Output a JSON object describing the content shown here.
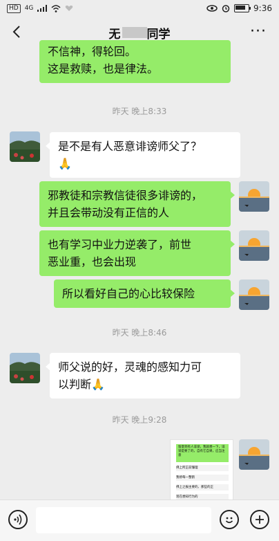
{
  "status_bar": {
    "left_badge": "HD",
    "network": "4G",
    "time": "9:36"
  },
  "header": {
    "title_prefix": "无",
    "title_suffix": "同学"
  },
  "messages": [
    {
      "side": "right",
      "line1": "不信神，得轮回。",
      "line2": "这是救赎，也是律法。"
    },
    {
      "side": "left",
      "line1": "是不是有人恶意诽谤师父了？",
      "line2": "🙏"
    },
    {
      "side": "right",
      "line1": "邪教徒和宗教信徒很多诽谤的，",
      "line2": "并且会带动没有正信的人"
    },
    {
      "side": "right",
      "line1": "也有学习中业力逆袭了，前世",
      "line2": "恶业重，也会出现"
    },
    {
      "side": "right",
      "line1": "所以看好自己的心比较保险"
    },
    {
      "side": "left",
      "line1": "师父说的好，灵魂的感知力可",
      "line2": "以判断🙏"
    }
  ],
  "timestamps": [
    "昨天 晚上8:33",
    "昨天 晚上8:46",
    "昨天 晚上9:28"
  ],
  "image_message": {
    "top_text": "留意到有人诽谤，我就想一下，诽谤是要了的，自有它自果，应当注意",
    "rows": [
      "佛上所正前懂理",
      "我修每一整鹤",
      "佛上之报主要的，那些的正",
      "现在想知行为的"
    ]
  },
  "colors": {
    "green_bubble": "#95ec69",
    "bg": "#ededed"
  },
  "icons": {
    "back": "back-arrow-icon",
    "more": "more-icon",
    "voice": "voice-icon",
    "emoji": "emoji-icon",
    "plus": "plus-icon"
  },
  "more_label": "···"
}
